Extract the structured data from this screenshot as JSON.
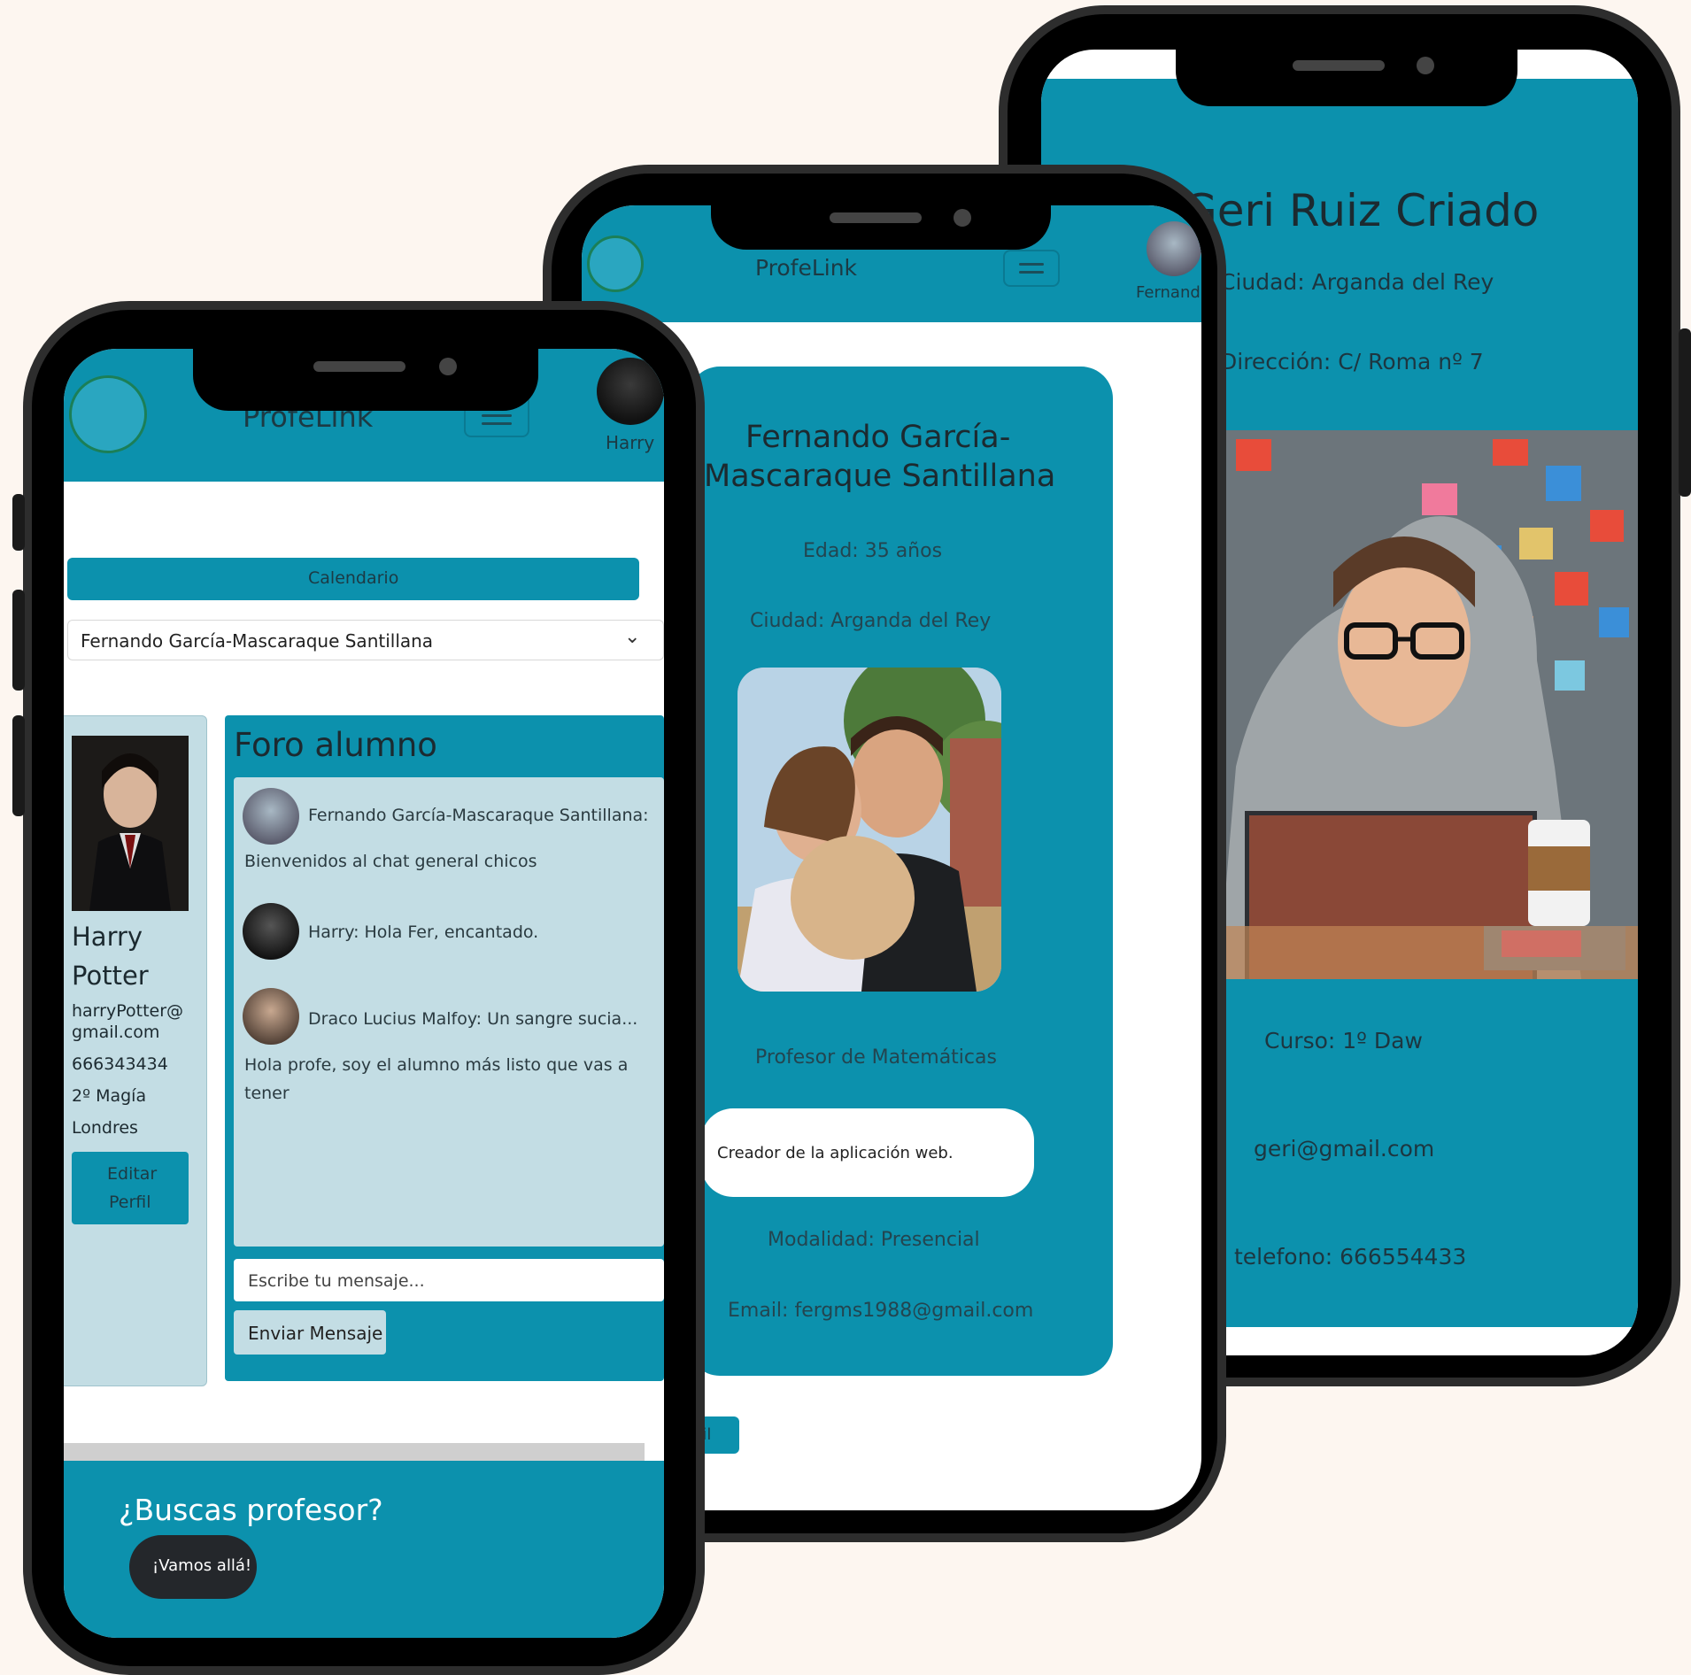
{
  "app_name": "ProfeLink",
  "phone3": {
    "name": "Geri Ruiz Criado",
    "ciudad": "Ciudad: Arganda del Rey",
    "direccion": "Dirección: C/ Roma nº 7",
    "curso": "Curso: 1º Daw",
    "email": "geri@gmail.com",
    "telefono": "telefono: 666554433"
  },
  "phone2": {
    "user_short": "Fernand",
    "name_line1": "Fernando García-",
    "name_line2": "Mascaraque Santillana",
    "edad": "Edad: 35 años",
    "ciudad": "Ciudad: Arganda del Rey",
    "profesion": "Profesor de Matemáticas",
    "descripcion": "Creador de la aplicación web.",
    "modalidad": "Modalidad: Presencial",
    "email": "Email: fergms1988@gmail.com",
    "bottom_button": "fil"
  },
  "phone1": {
    "user_name": "Harry",
    "calendar_button": "Calendario",
    "select_value": "Fernando García-Mascaraque Santillana",
    "profile": {
      "first_name": "Harry",
      "last_name": "Potter",
      "email_line1": "harryPotter@",
      "email_line2": "gmail.com",
      "phone": "666343434",
      "course": "2º Magía",
      "city": "Londres",
      "edit_line1": "Editar",
      "edit_line2": "Perfil"
    },
    "forum": {
      "title": "Foro alumno",
      "messages": [
        {
          "author": "Fernando García-Mascaraque Santillana:",
          "text": "Bienvenidos al chat general chicos"
        },
        {
          "author": "Harry: Hola Fer, encantado.",
          "text": ""
        },
        {
          "author": "Draco Lucius Malfoy: Un sangre sucia...",
          "text_line1": "Hola profe, soy el alumno más listo que vas a",
          "text_line2": "tener"
        }
      ],
      "input_placeholder": "Escribe tu mensaje...",
      "send_button": "Enviar Mensaje"
    },
    "footer_title": "¿Buscas profesor?",
    "footer_button": "¡Vamos allá!"
  }
}
